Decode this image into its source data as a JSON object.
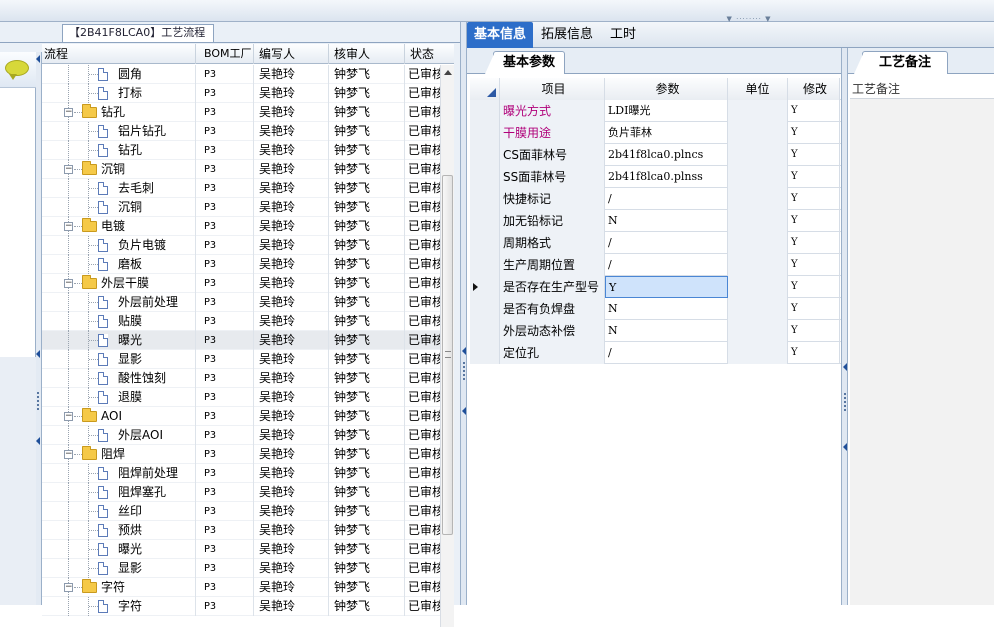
{
  "group_title": "【2B41F8LCA0】工艺流程",
  "tree": {
    "headers": [
      "流程",
      "BOM工厂",
      "编写人",
      "核审人",
      "状态"
    ],
    "rows": [
      {
        "kind": "doc",
        "level": 2,
        "label": "圆角",
        "bom": "P3",
        "author": "吴艳玲",
        "reviewer": "钟梦飞",
        "status": "已审核"
      },
      {
        "kind": "doc",
        "level": 2,
        "label": "打标",
        "bom": "P3",
        "author": "吴艳玲",
        "reviewer": "钟梦飞",
        "status": "已审核"
      },
      {
        "kind": "folder",
        "level": 1,
        "label": "钻孔",
        "bom": "P3",
        "author": "吴艳玲",
        "reviewer": "钟梦飞",
        "status": "已审核"
      },
      {
        "kind": "doc",
        "level": 2,
        "label": "铝片钻孔",
        "bom": "P3",
        "author": "吴艳玲",
        "reviewer": "钟梦飞",
        "status": "已审核"
      },
      {
        "kind": "doc",
        "level": 2,
        "label": "钻孔",
        "bom": "P3",
        "author": "吴艳玲",
        "reviewer": "钟梦飞",
        "status": "已审核"
      },
      {
        "kind": "folder",
        "level": 1,
        "label": "沉铜",
        "bom": "P3",
        "author": "吴艳玲",
        "reviewer": "钟梦飞",
        "status": "已审核"
      },
      {
        "kind": "doc",
        "level": 2,
        "label": "去毛刺",
        "bom": "P3",
        "author": "吴艳玲",
        "reviewer": "钟梦飞",
        "status": "已审核"
      },
      {
        "kind": "doc",
        "level": 2,
        "label": "沉铜",
        "bom": "P3",
        "author": "吴艳玲",
        "reviewer": "钟梦飞",
        "status": "已审核"
      },
      {
        "kind": "folder",
        "level": 1,
        "label": "电镀",
        "bom": "P3",
        "author": "吴艳玲",
        "reviewer": "钟梦飞",
        "status": "已审核"
      },
      {
        "kind": "doc",
        "level": 2,
        "label": "负片电镀",
        "bom": "P3",
        "author": "吴艳玲",
        "reviewer": "钟梦飞",
        "status": "已审核"
      },
      {
        "kind": "doc",
        "level": 2,
        "label": "磨板",
        "bom": "P3",
        "author": "吴艳玲",
        "reviewer": "钟梦飞",
        "status": "已审核"
      },
      {
        "kind": "folder",
        "level": 1,
        "label": "外层干膜",
        "bom": "P3",
        "author": "吴艳玲",
        "reviewer": "钟梦飞",
        "status": "已审核"
      },
      {
        "kind": "doc",
        "level": 2,
        "label": "外层前处理",
        "bom": "P3",
        "author": "吴艳玲",
        "reviewer": "钟梦飞",
        "status": "已审核"
      },
      {
        "kind": "doc",
        "level": 2,
        "label": "贴膜",
        "bom": "P3",
        "author": "吴艳玲",
        "reviewer": "钟梦飞",
        "status": "已审核"
      },
      {
        "kind": "doc",
        "level": 2,
        "label": "曝光",
        "bom": "P3",
        "author": "吴艳玲",
        "reviewer": "钟梦飞",
        "status": "已审核",
        "selected": true
      },
      {
        "kind": "doc",
        "level": 2,
        "label": "显影",
        "bom": "P3",
        "author": "吴艳玲",
        "reviewer": "钟梦飞",
        "status": "已审核"
      },
      {
        "kind": "doc",
        "level": 2,
        "label": "酸性蚀刻",
        "bom": "P3",
        "author": "吴艳玲",
        "reviewer": "钟梦飞",
        "status": "已审核"
      },
      {
        "kind": "doc",
        "level": 2,
        "label": "退膜",
        "bom": "P3",
        "author": "吴艳玲",
        "reviewer": "钟梦飞",
        "status": "已审核"
      },
      {
        "kind": "folder",
        "level": 1,
        "label": "AOI",
        "bom": "P3",
        "author": "吴艳玲",
        "reviewer": "钟梦飞",
        "status": "已审核"
      },
      {
        "kind": "doc",
        "level": 2,
        "label": "外层AOI",
        "bom": "P3",
        "author": "吴艳玲",
        "reviewer": "钟梦飞",
        "status": "已审核"
      },
      {
        "kind": "folder",
        "level": 1,
        "label": "阻焊",
        "bom": "P3",
        "author": "吴艳玲",
        "reviewer": "钟梦飞",
        "status": "已审核"
      },
      {
        "kind": "doc",
        "level": 2,
        "label": "阻焊前处理",
        "bom": "P3",
        "author": "吴艳玲",
        "reviewer": "钟梦飞",
        "status": "已审核"
      },
      {
        "kind": "doc",
        "level": 2,
        "label": "阻焊塞孔",
        "bom": "P3",
        "author": "吴艳玲",
        "reviewer": "钟梦飞",
        "status": "已审核"
      },
      {
        "kind": "doc",
        "level": 2,
        "label": "丝印",
        "bom": "P3",
        "author": "吴艳玲",
        "reviewer": "钟梦飞",
        "status": "已审核"
      },
      {
        "kind": "doc",
        "level": 2,
        "label": "预烘",
        "bom": "P3",
        "author": "吴艳玲",
        "reviewer": "钟梦飞",
        "status": "已审核"
      },
      {
        "kind": "doc",
        "level": 2,
        "label": "曝光",
        "bom": "P3",
        "author": "吴艳玲",
        "reviewer": "钟梦飞",
        "status": "已审核"
      },
      {
        "kind": "doc",
        "level": 2,
        "label": "显影",
        "bom": "P3",
        "author": "吴艳玲",
        "reviewer": "钟梦飞",
        "status": "已审核"
      },
      {
        "kind": "folder",
        "level": 1,
        "label": "字符",
        "bom": "P3",
        "author": "吴艳玲",
        "reviewer": "钟梦飞",
        "status": "已审核"
      },
      {
        "kind": "doc",
        "level": 2,
        "label": "字符",
        "bom": "P3",
        "author": "吴艳玲",
        "reviewer": "钟梦飞",
        "status": "已审核"
      }
    ]
  },
  "tabs": [
    "基本信息",
    "拓展信息",
    "工时"
  ],
  "active_tab": 0,
  "basic_params": {
    "title": "基本参数",
    "headers": [
      "项目",
      "参数",
      "单位",
      "修改"
    ],
    "rows": [
      {
        "item": "曝光方式",
        "value": "LDI曝光",
        "unit": "",
        "modified": "Y",
        "highlight": true
      },
      {
        "item": "干膜用途",
        "value": "负片菲林",
        "unit": "",
        "modified": "Y",
        "highlight": true
      },
      {
        "item": "CS面菲林号",
        "value": "2b41f8lca0.plncs",
        "unit": "",
        "modified": "Y"
      },
      {
        "item": "SS面菲林号",
        "value": "2b41f8lca0.plnss",
        "unit": "",
        "modified": "Y"
      },
      {
        "item": "快捷标记",
        "value": "/",
        "unit": "",
        "modified": "Y"
      },
      {
        "item": "加无铅标记",
        "value": "N",
        "unit": "",
        "modified": "Y"
      },
      {
        "item": "周期格式",
        "value": "/",
        "unit": "",
        "modified": "Y"
      },
      {
        "item": "生产周期位置",
        "value": "/",
        "unit": "",
        "modified": "Y"
      },
      {
        "item": "是否存在生产型号",
        "value": "Y",
        "unit": "",
        "modified": "Y",
        "editing": true
      },
      {
        "item": "是否有负焊盘",
        "value": "N",
        "unit": "",
        "modified": "Y"
      },
      {
        "item": "外层动态补偿",
        "value": "N",
        "unit": "",
        "modified": "Y"
      },
      {
        "item": "定位孔",
        "value": "/",
        "unit": "",
        "modified": "Y"
      }
    ]
  },
  "notes": {
    "title": "工艺备注",
    "label": "工艺备注",
    "text": ""
  }
}
